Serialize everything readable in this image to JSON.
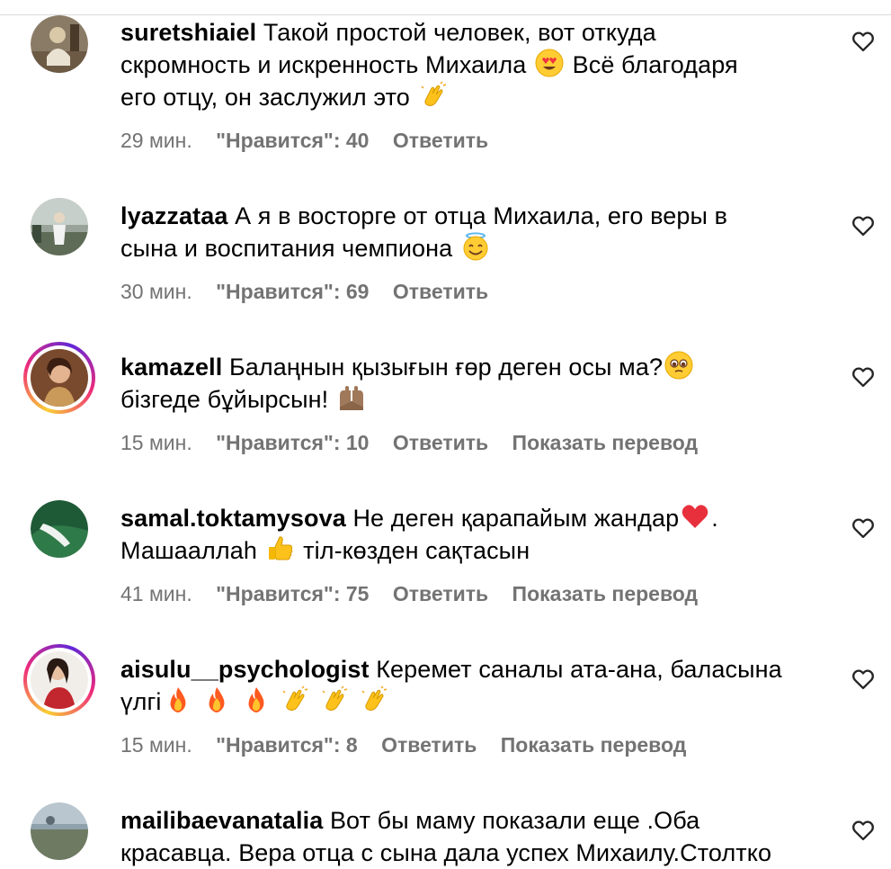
{
  "comments": [
    {
      "username": "suretshiaiel",
      "lines": [
        "Такой простой человек, вот откуда",
        "скромность и искренность Михаила",
        "Всё благодаря",
        "его отцу, он заслужил это"
      ],
      "emojis": [
        "smiling-heart-eyes-emoji",
        "clapping-hands-emoji"
      ],
      "time": "29 мин.",
      "likes": "\"Нравится\": 40",
      "reply": "Ответить",
      "translate": ""
    },
    {
      "username": "lyazzataa",
      "lines": [
        "А я в восторге от отца Михаила, его веры в",
        "сына и воспитания чемпиона"
      ],
      "emojis": [
        "smiling-halo-emoji"
      ],
      "time": "30 мин.",
      "likes": "\"Нравится\": 69",
      "reply": "Ответить",
      "translate": ""
    },
    {
      "username": "kamazell",
      "lines": [
        "Балаңнын қызығын ғөр деген осы ма?",
        "бізгеде бұйырсын!"
      ],
      "emojis": [
        "pleading-face-emoji",
        "palms-up-together-emoji"
      ],
      "time": "15 мин.",
      "likes": "\"Нравится\": 10",
      "reply": "Ответить",
      "translate": "Показать перевод"
    },
    {
      "username": "samal.toktamysova",
      "lines": [
        "Не деген қарапайым жандар",
        ".",
        "Машааллаh",
        "тіл-көзден сақтасын"
      ],
      "emojis": [
        "red-heart-emoji",
        "thumbs-up-emoji"
      ],
      "time": "41 мин.",
      "likes": "\"Нравится\": 75",
      "reply": "Ответить",
      "translate": "Показать перевод"
    },
    {
      "username": "aisulu__psychologist",
      "lines": [
        "Керемет саналы ата-ана, баласына",
        "үлгі"
      ],
      "emojis": [
        "fire-emoji",
        "clapping-hands-emoji"
      ],
      "time": "15 мин.",
      "likes": "\"Нравится\": 8",
      "reply": "Ответить",
      "translate": "Показать перевод"
    },
    {
      "username": "mailibaevanatalia",
      "lines": [
        "Вот бы маму показали еще .Оба",
        "красавца. Вера отца с сына дала успех Михаилу.Столтко"
      ],
      "emojis": [],
      "time": "",
      "likes": "",
      "reply": "",
      "translate": ""
    }
  ],
  "icons": {
    "like": "heart-outline-icon"
  },
  "colors": {
    "text": "#000000",
    "meta": "#737373",
    "story_ring": "#ee2a7b"
  }
}
